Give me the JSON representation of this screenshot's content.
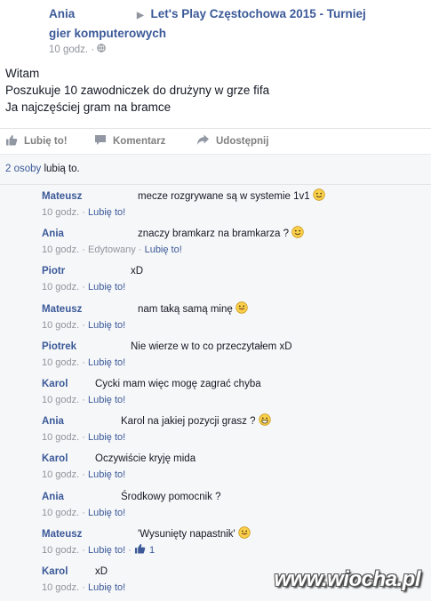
{
  "header": {
    "author": "Ania",
    "group_line1": "Let's Play Częstochowa 2015 - Turniej",
    "group_line2": "gier komputerowych",
    "time": "10 godz."
  },
  "post": {
    "lines": [
      "Witam",
      "Poszukuje 10 zawodniczek do drużyny w grze fifa",
      "Ja najczęściej gram na bramce"
    ]
  },
  "actions": {
    "like": "Lubię to!",
    "comment": "Komentarz",
    "share": "Udostępnij"
  },
  "likes": {
    "count_text": "2 osoby",
    "suffix": " lubią to."
  },
  "comments": [
    {
      "author": "Mateusz",
      "text": "mecze rozgrywane są w systemie 1v1",
      "time": "10 godz.",
      "edited": "",
      "like": "Lubię to!",
      "like_count": "",
      "emoji": "smile"
    },
    {
      "author": "Ania",
      "text": "znaczy bramkarz na bramkarza ?",
      "time": "10 godz.",
      "edited": "Edytowany",
      "like": "Lubię to!",
      "like_count": "",
      "emoji": "smile"
    },
    {
      "author": "Piotr",
      "text": "xD",
      "time": "10 godz.",
      "edited": "",
      "like": "Lubię to!",
      "like_count": "",
      "emoji": ""
    },
    {
      "author": "Mateusz",
      "text": "nam taką samą minę",
      "time": "10 godz.",
      "edited": "",
      "like": "Lubię to!",
      "like_count": "",
      "emoji": "tongue"
    },
    {
      "author": "Piotrek",
      "text": "Nie wierze w to co przeczytałem xD",
      "time": "10 godz.",
      "edited": "",
      "like": "Lubię to!",
      "like_count": "",
      "emoji": ""
    },
    {
      "author": "Karol",
      "text": "Cycki mam więc mogę zagrać chyba",
      "time": "10 godz.",
      "edited": "",
      "like": "Lubię to!",
      "like_count": "",
      "emoji": ""
    },
    {
      "author": "Ania",
      "text": "Karol na jakiej pozycji grasz ?",
      "time": "10 godz.",
      "edited": "",
      "like": "Lubię to!",
      "like_count": "",
      "emoji": "grin"
    },
    {
      "author": "Karol",
      "text": "Oczywiście kryję mida",
      "time": "10 godz.",
      "edited": "",
      "like": "Lubię to!",
      "like_count": "",
      "emoji": ""
    },
    {
      "author": "Ania",
      "text": "Środkowy pomocnik ?",
      "time": "10 godz.",
      "edited": "",
      "like": "Lubię to!",
      "like_count": "",
      "emoji": ""
    },
    {
      "author": "Mateusz",
      "text": "'Wysunięty napastnik'",
      "time": "10 godz.",
      "edited": "",
      "like": "Lubię to!",
      "like_count": "1",
      "emoji": "tongue"
    },
    {
      "author": "Karol",
      "text": "xD",
      "time": "10 godz.",
      "edited": "",
      "like": "Lubię to!",
      "like_count": "",
      "emoji": ""
    }
  ],
  "watermark": "www.wiocha.pl",
  "colors": {
    "link": "#3b5998",
    "meta": "#90949c",
    "text": "#141823",
    "comments_bg": "#f6f7f9"
  },
  "icons": [
    "globe-icon",
    "thumbs-up-icon",
    "comment-icon",
    "share-arrow-icon",
    "smile-emoji-icon",
    "tongue-emoji-icon",
    "grin-emoji-icon"
  ]
}
